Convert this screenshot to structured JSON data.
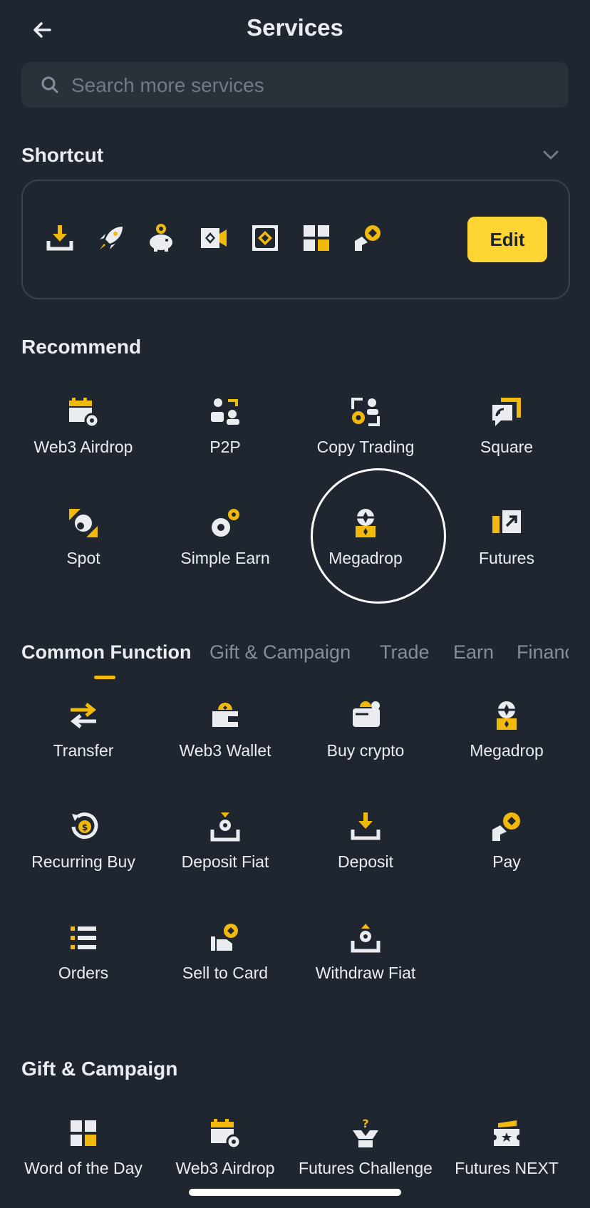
{
  "header": {
    "title": "Services"
  },
  "search": {
    "placeholder": "Search more services"
  },
  "shortcut": {
    "title": "Shortcut",
    "edit_label": "Edit",
    "icons": [
      "deposit-icon",
      "rocket-icon",
      "piggy-bank-icon",
      "binance-pay-icon",
      "launchpool-icon",
      "grid-icon",
      "pay-icon"
    ]
  },
  "recommend": {
    "title": "Recommend",
    "items": [
      {
        "label": "Web3 Airdrop",
        "icon": "calendar-airdrop-icon"
      },
      {
        "label": "P2P",
        "icon": "people-icon"
      },
      {
        "label": "Copy Trading",
        "icon": "copy-trading-icon"
      },
      {
        "label": "Square",
        "icon": "square-icon"
      },
      {
        "label": "Spot",
        "icon": "spot-icon"
      },
      {
        "label": "Simple Earn",
        "icon": "coins-icon"
      },
      {
        "label": "Megadrop",
        "icon": "megadrop-icon"
      },
      {
        "label": "Futures",
        "icon": "futures-icon"
      }
    ]
  },
  "tabs": [
    "Common Function",
    "Gift & Campaign",
    "Trade",
    "Earn",
    "Finance"
  ],
  "common": {
    "items": [
      {
        "label": "Transfer",
        "icon": "transfer-icon"
      },
      {
        "label": "Web3 Wallet",
        "icon": "wallet-icon"
      },
      {
        "label": "Buy crypto",
        "icon": "buy-crypto-icon"
      },
      {
        "label": "Megadrop",
        "icon": "megadrop-icon"
      },
      {
        "label": "Recurring Buy",
        "icon": "recurring-icon"
      },
      {
        "label": "Deposit Fiat",
        "icon": "deposit-fiat-icon"
      },
      {
        "label": "Deposit",
        "icon": "deposit-icon"
      },
      {
        "label": "Pay",
        "icon": "pay-icon"
      },
      {
        "label": "Orders",
        "icon": "orders-icon"
      },
      {
        "label": "Sell to Card",
        "icon": "sell-card-icon"
      },
      {
        "label": "Withdraw Fiat",
        "icon": "withdraw-fiat-icon"
      }
    ]
  },
  "gift": {
    "title": "Gift & Campaign",
    "items": [
      {
        "label": "Word of the Day",
        "icon": "grid-icon"
      },
      {
        "label": "Web3 Airdrop",
        "icon": "calendar-airdrop-icon"
      },
      {
        "label": "Futures Challenge",
        "icon": "challenge-icon"
      },
      {
        "label": "Futures NEXT",
        "icon": "ticket-icon"
      }
    ]
  },
  "colors": {
    "accent": "#F0B90B",
    "background": "#202630",
    "text": "#EAECEF",
    "muted": "#848E9C",
    "button": "#FCD535"
  }
}
